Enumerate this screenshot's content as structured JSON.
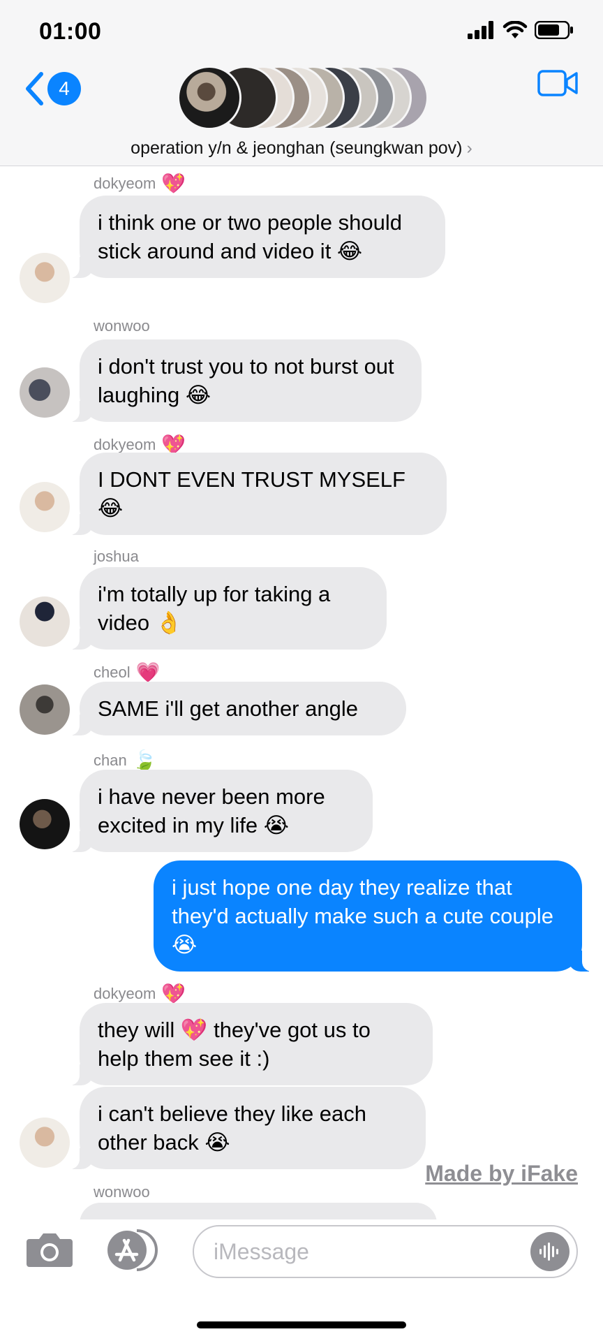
{
  "status": {
    "time": "01:00"
  },
  "header": {
    "back_count": "4",
    "group_title": "operation y/n & jeonghan (seungkwan pov)",
    "chevron": "›"
  },
  "messages": [
    {
      "sender": "dokyeom",
      "sender_emoji": "💖",
      "text": "i think one or two people should stick around and video it 😂"
    },
    {
      "sender": "wonwoo",
      "sender_emoji": "",
      "text": "i don't trust you to not burst out laughing 😂"
    },
    {
      "sender": "dokyeom",
      "sender_emoji": "💖",
      "text": "I DONT EVEN TRUST MYSELF 😂"
    },
    {
      "sender": "joshua",
      "sender_emoji": "",
      "text": "i'm totally up for taking a video 👌"
    },
    {
      "sender": "cheol",
      "sender_emoji": "💗",
      "text": "SAME i'll get another angle"
    },
    {
      "sender": "chan",
      "sender_emoji": "🍃",
      "text": "i have never been more excited in my life 😭"
    },
    {
      "sender": "",
      "sender_emoji": "",
      "text": "i just hope one day they realize that they'd actually make such a cute couple 😭"
    },
    {
      "sender": "dokyeom",
      "sender_emoji": "💖",
      "text": "they will 💖 they've got us to help them see it :)"
    },
    {
      "sender": "",
      "sender_emoji": "",
      "text": "i can't believe they like each other back 😭"
    },
    {
      "sender": "wonwoo",
      "sender_emoji": "",
      "text": ""
    }
  ],
  "watermark": "Made by iFake",
  "input": {
    "placeholder": "iMessage"
  },
  "colors": {
    "accent": "#0a84ff",
    "incoming_bubble": "#e9e9eb",
    "header_bg": "#f6f6f7"
  },
  "icons": [
    "back-chevron-icon",
    "video-camera-icon",
    "camera-icon",
    "app-store-icon",
    "audio-wave-icon",
    "signal-icon",
    "wifi-icon",
    "battery-icon"
  ]
}
